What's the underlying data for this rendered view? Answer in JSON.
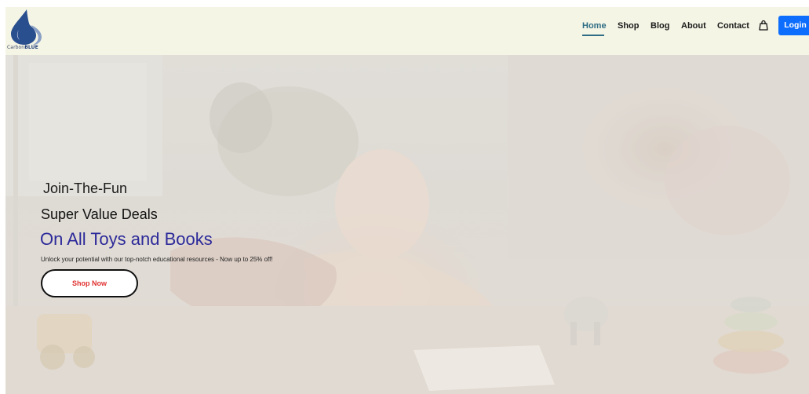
{
  "header": {
    "logo_text_prefix": "Carbon",
    "logo_text_suffix": "BLUE",
    "nav": [
      {
        "label": "Home",
        "active": true
      },
      {
        "label": "Shop"
      },
      {
        "label": "Blog"
      },
      {
        "label": "About"
      },
      {
        "label": "Contact"
      }
    ],
    "cart_icon": "shopping-bag-icon",
    "login_label": "Login"
  },
  "hero": {
    "line1": "Join-The-Fun",
    "line2": "Super Value Deals",
    "headline": "On All Toys and Books",
    "subtitle": "Unlock your potential with our top-notch educational resources - Now up to 25% off!",
    "cta_label": "Shop Now"
  },
  "colors": {
    "nav_bg": "#f5f5e6",
    "accent_active": "#2f6d84",
    "login_bg": "#0d6efd",
    "headline": "#2d2a9a",
    "cta_text": "#e0302f"
  }
}
